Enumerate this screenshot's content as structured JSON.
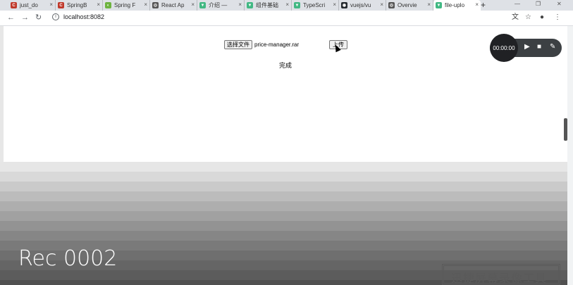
{
  "browser": {
    "tabs": [
      {
        "label": "just_do",
        "color": "#c0392b",
        "glyph": "C"
      },
      {
        "label": "SpringB",
        "color": "#c0392b",
        "glyph": "C"
      },
      {
        "label": "Spring F",
        "color": "#6db33f",
        "glyph": "◐"
      },
      {
        "label": "React Ap",
        "color": "#555555",
        "glyph": "◎"
      },
      {
        "label": "介绍 —",
        "color": "#41b883",
        "glyph": "▼"
      },
      {
        "label": "组件基础",
        "color": "#41b883",
        "glyph": "▼"
      },
      {
        "label": "TypeScri",
        "color": "#41b883",
        "glyph": "▼"
      },
      {
        "label": "vuejs/vu",
        "color": "#24292e",
        "glyph": "◉"
      },
      {
        "label": "Overvie",
        "color": "#555555",
        "glyph": "◎"
      },
      {
        "label": "file-uplo",
        "color": "#41b883",
        "glyph": "▼"
      }
    ],
    "new_tab": "+",
    "address": "localhost:8082",
    "window_controls": {
      "minimize": "—",
      "maximize": "❐",
      "close": "✕"
    }
  },
  "page": {
    "choose_file_label": "选择文件",
    "file_name": "price-manager.rar",
    "upload_label": "上传",
    "status_text": "完成"
  },
  "recorder": {
    "time": "00:00:00"
  },
  "overlay": {
    "rec_label": "Rec 0002",
    "watermark": "迅捷屏幕录像工具"
  }
}
